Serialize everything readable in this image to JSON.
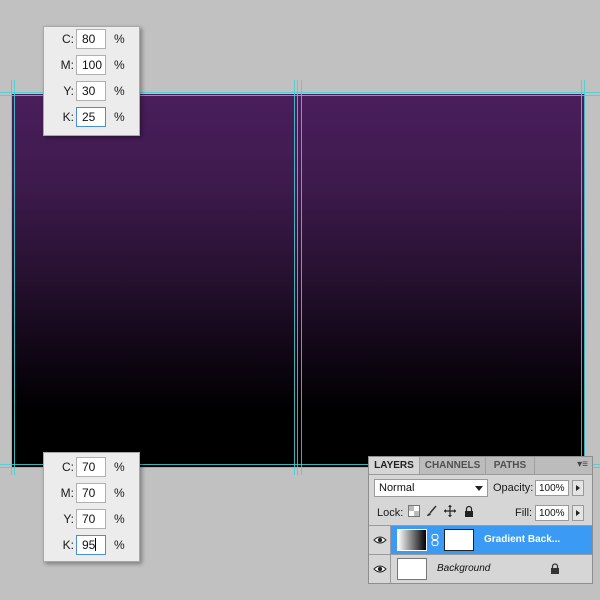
{
  "cmyk_top": {
    "rows": [
      {
        "label": "C:",
        "value": "80",
        "unit": "%"
      },
      {
        "label": "M:",
        "value": "100",
        "unit": "%"
      },
      {
        "label": "Y:",
        "value": "30",
        "unit": "%"
      },
      {
        "label": "K:",
        "value": "25",
        "unit": "%"
      }
    ]
  },
  "cmyk_bottom": {
    "rows": [
      {
        "label": "C:",
        "value": "70",
        "unit": "%"
      },
      {
        "label": "M:",
        "value": "70",
        "unit": "%"
      },
      {
        "label": "Y:",
        "value": "70",
        "unit": "%"
      },
      {
        "label": "K:",
        "value": "95",
        "unit": "%"
      }
    ]
  },
  "layers_panel": {
    "tabs": [
      "LAYERS",
      "CHANNELS",
      "PATHS"
    ],
    "menu_glyph": "▾≡",
    "blend_mode": "Normal",
    "opacity_label": "Opacity:",
    "opacity_value": "100%",
    "lock_label": "Lock:",
    "fill_label": "Fill:",
    "fill_value": "100%",
    "layers": [
      {
        "name": "Gradient Back...",
        "selected": true
      },
      {
        "name": "Background",
        "selected": false
      }
    ]
  },
  "colors": {
    "canvas_top": "#4a1e5c",
    "canvas_bottom": "#000000",
    "guide": "#3fd2d8",
    "selection": "#3b9bf4"
  }
}
